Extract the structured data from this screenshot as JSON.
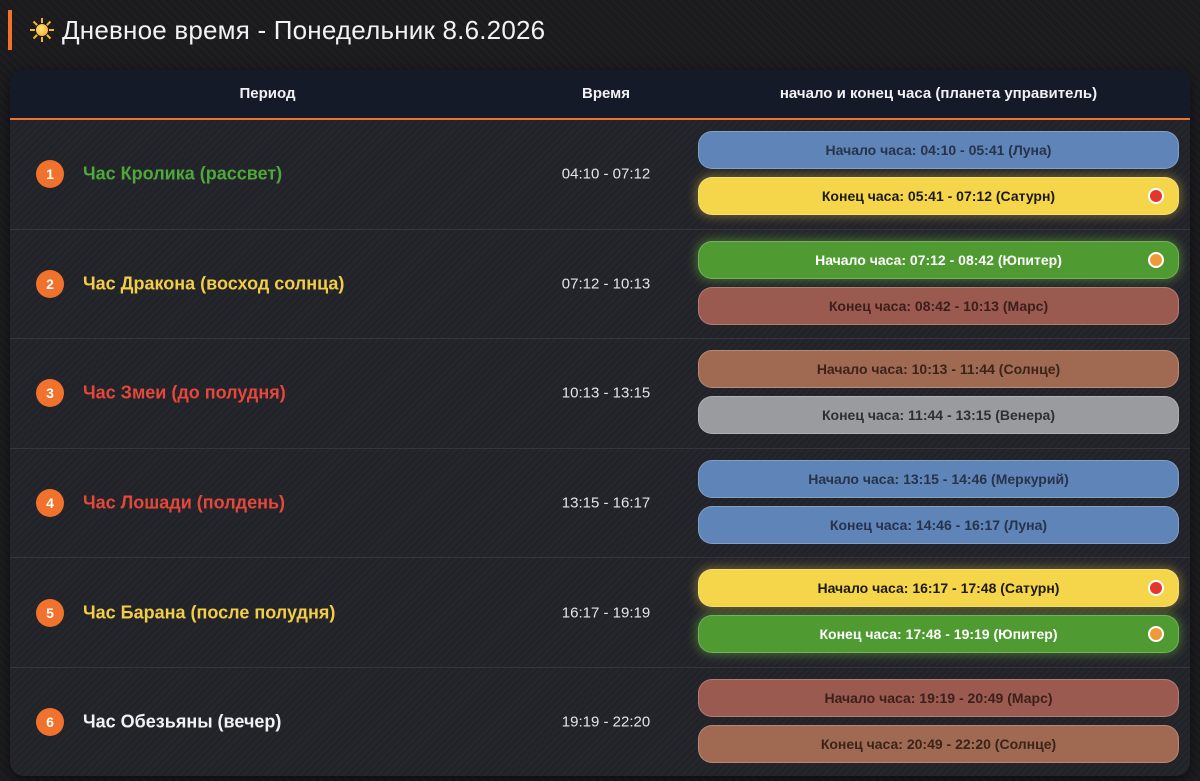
{
  "header": {
    "title": "Дневное время - Понедельник 8.6.2026",
    "icon": "sun-icon"
  },
  "table": {
    "columns": {
      "period": "Период",
      "time": "Время",
      "hours": "начало и конец часа (планета управитель)"
    },
    "rows": [
      {
        "num": "1",
        "name": "Час Кролика (рассвет)",
        "name_color": "#4ea83a",
        "time": "04:10 - 07:12",
        "hours": [
          {
            "label": "Начало часа: 04:10 - 05:41 (Луна)",
            "bg": "#5f84b7",
            "fg": "#26334a",
            "active": false,
            "dot": null
          },
          {
            "label": "Конец часа: 05:41 - 07:12 (Сатурн)",
            "bg": "#f5d54a",
            "fg": "#1c1a10",
            "active": true,
            "dot": "#e5352f"
          }
        ]
      },
      {
        "num": "2",
        "name": "Час Дракона (восход солнца)",
        "name_color": "#f2cd45",
        "time": "07:12 - 10:13",
        "hours": [
          {
            "label": "Начало часа: 07:12 - 08:42 (Юпитер)",
            "bg": "#4f9a31",
            "fg": "#ffffff",
            "active": true,
            "dot": "#ef9a3a"
          },
          {
            "label": "Конец часа: 08:42 - 10:13 (Марс)",
            "bg": "#9a5a50",
            "fg": "#3b1f1a",
            "active": false,
            "dot": null
          }
        ]
      },
      {
        "num": "3",
        "name": "Час Змеи (до полудня)",
        "name_color": "#e5473a",
        "time": "10:13 - 13:15",
        "hours": [
          {
            "label": "Начало часа: 10:13 - 11:44 (Солнце)",
            "bg": "#a06a52",
            "fg": "#3a2419",
            "active": false,
            "dot": null
          },
          {
            "label": "Конец часа: 11:44 - 13:15 (Венера)",
            "bg": "#9a9b9f",
            "fg": "#2e2f33",
            "active": false,
            "dot": null
          }
        ]
      },
      {
        "num": "4",
        "name": "Час Лошади (полдень)",
        "name_color": "#e5473a",
        "time": "13:15 - 16:17",
        "hours": [
          {
            "label": "Начало часа: 13:15 - 14:46 (Меркурий)",
            "bg": "#5f84b7",
            "fg": "#26334a",
            "active": false,
            "dot": null
          },
          {
            "label": "Конец часа: 14:46 - 16:17 (Луна)",
            "bg": "#5f84b7",
            "fg": "#26334a",
            "active": false,
            "dot": null
          }
        ]
      },
      {
        "num": "5",
        "name": "Час Барана (после полудня)",
        "name_color": "#f2cd45",
        "time": "16:17 - 19:19",
        "hours": [
          {
            "label": "Начало часа: 16:17 - 17:48 (Сатурн)",
            "bg": "#f5d54a",
            "fg": "#1c1a10",
            "active": true,
            "dot": "#e5352f"
          },
          {
            "label": "Конец часа: 17:48 - 19:19 (Юпитер)",
            "bg": "#4f9a31",
            "fg": "#ffffff",
            "active": true,
            "dot": "#ef9a3a"
          }
        ]
      },
      {
        "num": "6",
        "name": "Час Обезьяны (вечер)",
        "name_color": "#f1f1f4",
        "time": "19:19 - 22:20",
        "hours": [
          {
            "label": "Начало часа: 19:19 - 20:49 (Марс)",
            "bg": "#9a5a50",
            "fg": "#3b1f1a",
            "active": false,
            "dot": null
          },
          {
            "label": "Конец часа: 20:49 - 22:20 (Солнце)",
            "bg": "#a06a52",
            "fg": "#3a2419",
            "active": false,
            "dot": null
          }
        ]
      }
    ]
  }
}
